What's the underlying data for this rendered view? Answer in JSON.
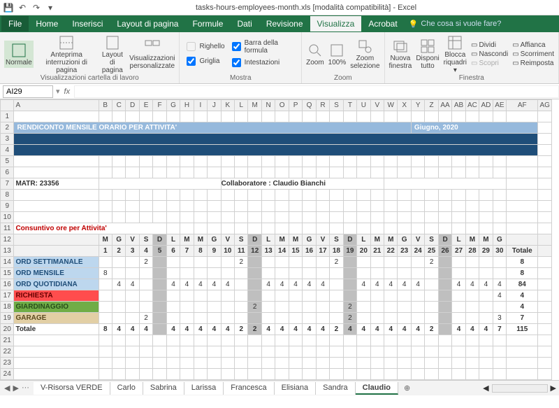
{
  "title": "tasks-hours-employees-month.xls  [modalità compatibilità] - Excel",
  "tabs": {
    "file": "File",
    "home": "Home",
    "inserisci": "Inserisci",
    "layout": "Layout di pagina",
    "formule": "Formule",
    "dati": "Dati",
    "revisione": "Revisione",
    "visualizza": "Visualizza",
    "acrobat": "Acrobat",
    "tellme": "Che cosa si vuole fare?"
  },
  "ribbon": {
    "views": {
      "normale": "Normale",
      "anteprima": "Anteprima\ninterruzioni di pagina",
      "layout": "Layout\ndi pagina",
      "viz": "Visualizzazioni\npersonalizzate",
      "label": "Visualizzazioni cartella di lavoro"
    },
    "mostra": {
      "righello": "Righello",
      "barra": "Barra della formula",
      "griglia": "Griglia",
      "intestazioni": "Intestazioni",
      "label": "Mostra"
    },
    "zoom": {
      "zoom": "Zoom",
      "p100": "100%",
      "sel": "Zoom\nselezione",
      "label": "Zoom"
    },
    "finestra": {
      "nuova": "Nuova\nfinestra",
      "disponi": "Disponi\ntutto",
      "blocca": "Blocca\nriquadri ▾",
      "dividi": "Dividi",
      "nascondi": "Nascondi",
      "scopri": "Scopri",
      "affianca": "Affianca",
      "scorr": "Scorriment",
      "reimp": "Reimposta",
      "label": "Finestra"
    }
  },
  "cellref": "AI29",
  "report": {
    "title": "RENDICONTO MENSILE ORARIO PER ATTIVITA'",
    "period": "Giugno, 2020",
    "matr": "MATR: 23356",
    "collab": "Collaboratore : Claudio Bianchi",
    "section": "Consuntivo ore per Attivita'",
    "weekdays": [
      "M",
      "G",
      "V",
      "S",
      "D",
      "L",
      "M",
      "M",
      "G",
      "V",
      "S",
      "D",
      "L",
      "M",
      "M",
      "G",
      "V",
      "S",
      "D",
      "L",
      "M",
      "M",
      "G",
      "V",
      "S",
      "D",
      "L",
      "M",
      "M",
      "G"
    ],
    "days": [
      "1",
      "2",
      "3",
      "4",
      "5",
      "6",
      "7",
      "8",
      "9",
      "10",
      "11",
      "12",
      "13",
      "14",
      "15",
      "16",
      "17",
      "18",
      "19",
      "20",
      "21",
      "22",
      "23",
      "24",
      "25",
      "26",
      "27",
      "28",
      "29",
      "30"
    ],
    "totale_hdr": "Totale",
    "activities": [
      {
        "name": "ORD SETTIMANALE",
        "cls": "act-blue",
        "vals": [
          "",
          "",
          "",
          "2",
          "",
          "",
          "",
          "",
          "",
          "",
          "2",
          "",
          "",
          "",
          "",
          "",
          "",
          "2",
          "",
          "",
          "",
          "",
          "",
          "",
          "2",
          "",
          "",
          "",
          "",
          ""
        ],
        "tot": "8"
      },
      {
        "name": "ORD MENSILE",
        "cls": "act-blue",
        "vals": [
          "8",
          "",
          "",
          "",
          "",
          "",
          "",
          "",
          "",
          "",
          "",
          "",
          "",
          "",
          "",
          "",
          "",
          "",
          "",
          "",
          "",
          "",
          "",
          "",
          "",
          "",
          "",
          "",
          "",
          ""
        ],
        "tot": "8"
      },
      {
        "name": "ORD QUOTIDIANA",
        "cls": "act-blue",
        "vals": [
          "",
          "4",
          "4",
          "",
          "",
          "4",
          "4",
          "4",
          "4",
          "4",
          "",
          "",
          "4",
          "4",
          "4",
          "4",
          "4",
          "",
          "",
          "4",
          "4",
          "4",
          "4",
          "4",
          "",
          "",
          "4",
          "4",
          "4",
          "4"
        ],
        "tot": "84"
      },
      {
        "name": "RICHIESTA",
        "cls": "act-red",
        "vals": [
          "",
          "",
          "",
          "",
          "",
          "",
          "",
          "",
          "",
          "",
          "",
          "",
          "",
          "",
          "",
          "",
          "",
          "",
          "",
          "",
          "",
          "",
          "",
          "",
          "",
          "",
          "",
          "",
          "",
          "4"
        ],
        "tot": "4"
      },
      {
        "name": "GIARDINAGGIO",
        "cls": "act-green",
        "vals": [
          "",
          "",
          "",
          "",
          "",
          "",
          "",
          "",
          "",
          "",
          "",
          "2",
          "",
          "",
          "",
          "",
          "",
          "",
          "2",
          "",
          "",
          "",
          "",
          "",
          "",
          "",
          "",
          "",
          "",
          ""
        ],
        "tot": "4"
      },
      {
        "name": "GARAGE",
        "cls": "act-tan",
        "vals": [
          "",
          "",
          "",
          "2",
          "",
          "",
          "",
          "",
          "",
          "",
          "",
          "",
          "",
          "",
          "",
          "",
          "",
          "",
          "2",
          "",
          "",
          "",
          "",
          "",
          "",
          "",
          "",
          "",
          "",
          "3"
        ],
        "tot": "7"
      }
    ],
    "total_label": "Totale",
    "total_vals": [
      "8",
      "4",
      "4",
      "4",
      "",
      "4",
      "4",
      "4",
      "4",
      "4",
      "2",
      "2",
      "4",
      "4",
      "4",
      "4",
      "4",
      "2",
      "4",
      "4",
      "4",
      "4",
      "4",
      "4",
      "2",
      "",
      "4",
      "4",
      "4",
      "7"
    ],
    "total_sum": "115"
  },
  "sheets": {
    "nav": "···",
    "items": [
      "V-Risorsa VERDE",
      "Carlo",
      "Sabrina",
      "Larissa",
      "Francesca",
      "Elisiana",
      "Sandra",
      "Claudio"
    ],
    "active": "Claudio",
    "add": "⊕"
  },
  "chart_data": {
    "type": "table",
    "title": "Consuntivo ore per Attivita' — Giugno 2020 — Claudio Bianchi (MATR 23356)",
    "categories": [
      "1",
      "2",
      "3",
      "4",
      "5",
      "6",
      "7",
      "8",
      "9",
      "10",
      "11",
      "12",
      "13",
      "14",
      "15",
      "16",
      "17",
      "18",
      "19",
      "20",
      "21",
      "22",
      "23",
      "24",
      "25",
      "26",
      "27",
      "28",
      "29",
      "30"
    ],
    "series": [
      {
        "name": "ORD SETTIMANALE",
        "values": [
          0,
          0,
          0,
          2,
          0,
          0,
          0,
          0,
          0,
          0,
          2,
          0,
          0,
          0,
          0,
          0,
          0,
          2,
          0,
          0,
          0,
          0,
          0,
          0,
          2,
          0,
          0,
          0,
          0,
          0
        ],
        "total": 8
      },
      {
        "name": "ORD MENSILE",
        "values": [
          8,
          0,
          0,
          0,
          0,
          0,
          0,
          0,
          0,
          0,
          0,
          0,
          0,
          0,
          0,
          0,
          0,
          0,
          0,
          0,
          0,
          0,
          0,
          0,
          0,
          0,
          0,
          0,
          0,
          0
        ],
        "total": 8
      },
      {
        "name": "ORD QUOTIDIANA",
        "values": [
          0,
          4,
          4,
          0,
          0,
          4,
          4,
          4,
          4,
          4,
          0,
          0,
          4,
          4,
          4,
          4,
          4,
          0,
          0,
          4,
          4,
          4,
          4,
          4,
          0,
          0,
          4,
          4,
          4,
          4
        ],
        "total": 84
      },
      {
        "name": "RICHIESTA",
        "values": [
          0,
          0,
          0,
          0,
          0,
          0,
          0,
          0,
          0,
          0,
          0,
          0,
          0,
          0,
          0,
          0,
          0,
          0,
          0,
          0,
          0,
          0,
          0,
          0,
          0,
          0,
          0,
          0,
          0,
          4
        ],
        "total": 4
      },
      {
        "name": "GIARDINAGGIO",
        "values": [
          0,
          0,
          0,
          0,
          0,
          0,
          0,
          0,
          0,
          0,
          0,
          2,
          0,
          0,
          0,
          0,
          0,
          0,
          2,
          0,
          0,
          0,
          0,
          0,
          0,
          0,
          0,
          0,
          0,
          0
        ],
        "total": 4
      },
      {
        "name": "GARAGE",
        "values": [
          0,
          0,
          0,
          2,
          0,
          0,
          0,
          0,
          0,
          0,
          0,
          0,
          0,
          0,
          0,
          0,
          0,
          0,
          2,
          0,
          0,
          0,
          0,
          0,
          0,
          0,
          0,
          0,
          0,
          3
        ],
        "total": 7
      }
    ],
    "totals_by_day": [
      8,
      4,
      4,
      4,
      0,
      4,
      4,
      4,
      4,
      4,
      2,
      2,
      4,
      4,
      4,
      4,
      4,
      2,
      4,
      4,
      4,
      4,
      4,
      4,
      2,
      0,
      4,
      4,
      4,
      7
    ],
    "grand_total": 115
  }
}
